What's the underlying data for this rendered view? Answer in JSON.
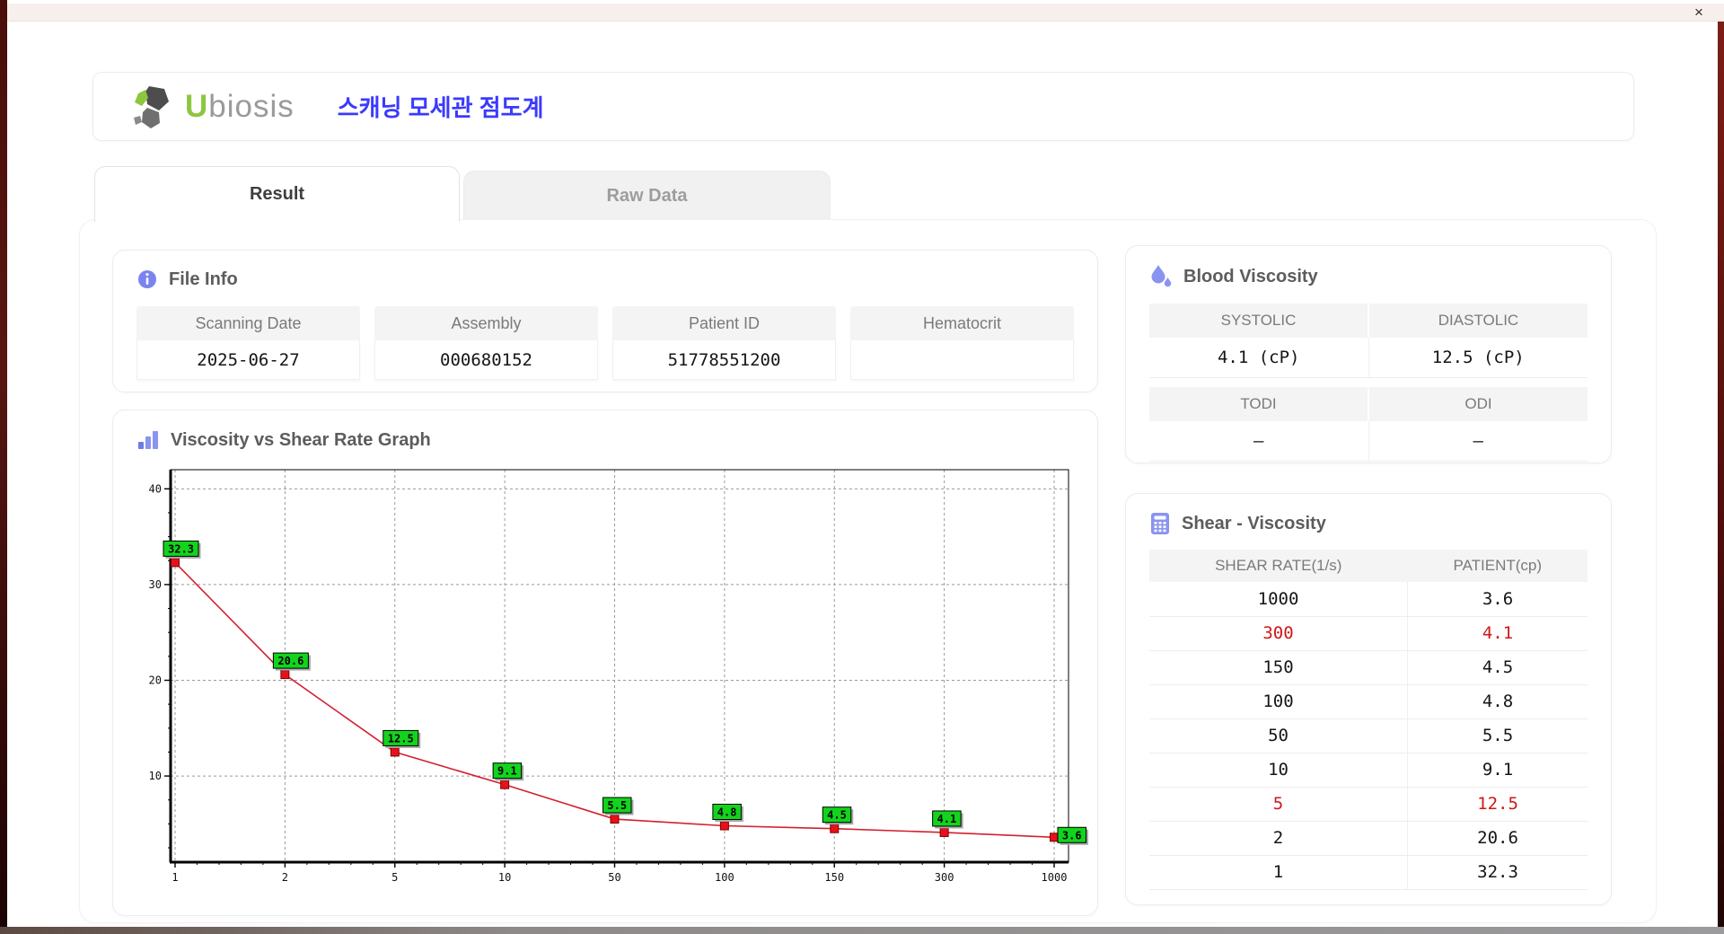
{
  "window": {
    "close_icon": "×"
  },
  "header": {
    "logo_u": "U",
    "logo_rest": "biosis",
    "title": "스캐닝 모세관 점도계"
  },
  "tabs": [
    {
      "label": "Result",
      "active": true
    },
    {
      "label": "Raw Data",
      "active": false
    }
  ],
  "file_info": {
    "title": "File Info",
    "fields": [
      {
        "label": "Scanning Date",
        "value": "2025-06-27"
      },
      {
        "label": "Assembly",
        "value": "000680152"
      },
      {
        "label": "Patient ID",
        "value": "51778551200"
      },
      {
        "label": "Hematocrit",
        "value": ""
      }
    ]
  },
  "blood_viscosity": {
    "title": "Blood Viscosity",
    "groups": [
      {
        "cols": [
          {
            "label": "SYSTOLIC",
            "value": "4.1 (cP)"
          },
          {
            "label": "DIASTOLIC",
            "value": "12.5 (cP)"
          }
        ]
      },
      {
        "cols": [
          {
            "label": "TODI",
            "value": "–"
          },
          {
            "label": "ODI",
            "value": "–"
          }
        ]
      }
    ]
  },
  "shear_viscosity": {
    "title": "Shear - Viscosity",
    "headers": [
      "SHEAR RATE(1/s)",
      "PATIENT(cp)"
    ],
    "rows": [
      {
        "shear_rate": "1000",
        "patient": "3.6",
        "highlight": false
      },
      {
        "shear_rate": "300",
        "patient": "4.1",
        "highlight": true
      },
      {
        "shear_rate": "150",
        "patient": "4.5",
        "highlight": false
      },
      {
        "shear_rate": "100",
        "patient": "4.8",
        "highlight": false
      },
      {
        "shear_rate": "50",
        "patient": "5.5",
        "highlight": false
      },
      {
        "shear_rate": "10",
        "patient": "9.1",
        "highlight": false
      },
      {
        "shear_rate": "5",
        "patient": "12.5",
        "highlight": true
      },
      {
        "shear_rate": "2",
        "patient": "20.6",
        "highlight": false
      },
      {
        "shear_rate": "1",
        "patient": "32.3",
        "highlight": false
      }
    ]
  },
  "chart_data": {
    "type": "line",
    "title": "Viscosity vs Shear Rate Graph",
    "x_categories": [
      "1",
      "2",
      "5",
      "10",
      "50",
      "100",
      "150",
      "300",
      "1000"
    ],
    "series": [
      {
        "name": "PATIENT(cp)",
        "values": [
          32.3,
          20.6,
          12.5,
          9.1,
          5.5,
          4.8,
          4.5,
          4.1,
          3.6
        ]
      }
    ],
    "point_labels": [
      "32.3",
      "20.6",
      "12.5",
      "9.1",
      "5.5",
      "4.8",
      "4.5",
      "4.1",
      "3.6"
    ],
    "xlabel": "",
    "ylabel": "",
    "y_ticks": [
      10,
      20,
      30,
      40
    ],
    "ylim": [
      1,
      42
    ],
    "x_scale": "categorical (log-spaced shear rates)",
    "grid": "dashed",
    "legend": "none",
    "colors": {
      "line": "#d42030",
      "marker": "#e8111a",
      "marker_border": "#7d0000",
      "label_bg": "#12d41c",
      "label_border": "#000000",
      "label_shadow": "#a8a8a8",
      "grid": "#9a9a9a",
      "axis": "#000000"
    }
  },
  "colors": {
    "accent_purple": "#8a93f0",
    "logo_green": "#8dc63f",
    "title_blue": "#3a3aff",
    "highlight_red": "#d01717",
    "titlebar_pink": "#f7efeb"
  }
}
